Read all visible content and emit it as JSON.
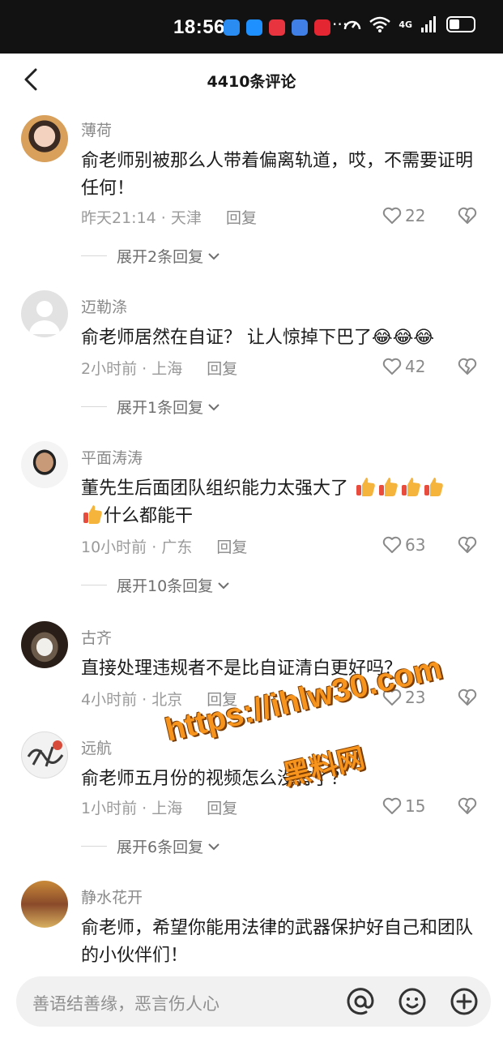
{
  "status_bar": {
    "time": "18:56",
    "dots": "···",
    "network": "4G"
  },
  "header": {
    "title": "4410条评论"
  },
  "comments": [
    {
      "username": "薄荷",
      "text": "俞老师别被那么人带着偏离轨道，哎，不需要证明任何！",
      "time": "昨天21:14",
      "location": "天津",
      "reply": "回复",
      "likes": "22",
      "expand": "展开2条回复"
    },
    {
      "username": "迈勒涤",
      "text": "俞老师居然在自证？ 让人惊掉下巴了",
      "emoji": "😂😂😂",
      "time": "2小时前",
      "location": "上海",
      "reply": "回复",
      "likes": "42",
      "expand": "展开1条回复"
    },
    {
      "username": "平面涛涛",
      "text": "董先生后面团队组织能力太强大了",
      "text2": "什么都能干",
      "time": "10小时前",
      "location": "广东",
      "reply": "回复",
      "likes": "63",
      "expand": "展开10条回复"
    },
    {
      "username": "古齐",
      "text": "直接处理违规者不是比自证清白更好吗？",
      "time": "4小时前",
      "location": "北京",
      "reply": "回复",
      "likes": "23"
    },
    {
      "username": "远航",
      "text": "俞老师五月份的视频怎么没有了？",
      "time": "1小时前",
      "location": "上海",
      "reply": "回复",
      "likes": "15",
      "expand": "展开6条回复"
    },
    {
      "username": "静水花开",
      "text": "俞老师，希望你能用法律的武器保护好自己和团队的小伙伴们！"
    }
  ],
  "watermark": {
    "url": "https://ihlw30.com",
    "name": "黑料网"
  },
  "input_bar": {
    "placeholder": "善语结善缘，恶言伤人心"
  },
  "icons": {
    "back": "chevron-left-icon",
    "like": "heart-icon",
    "dislike": "broken-heart-icon",
    "mention": "at-icon",
    "emoji": "smiley-icon",
    "add": "plus-icon"
  }
}
